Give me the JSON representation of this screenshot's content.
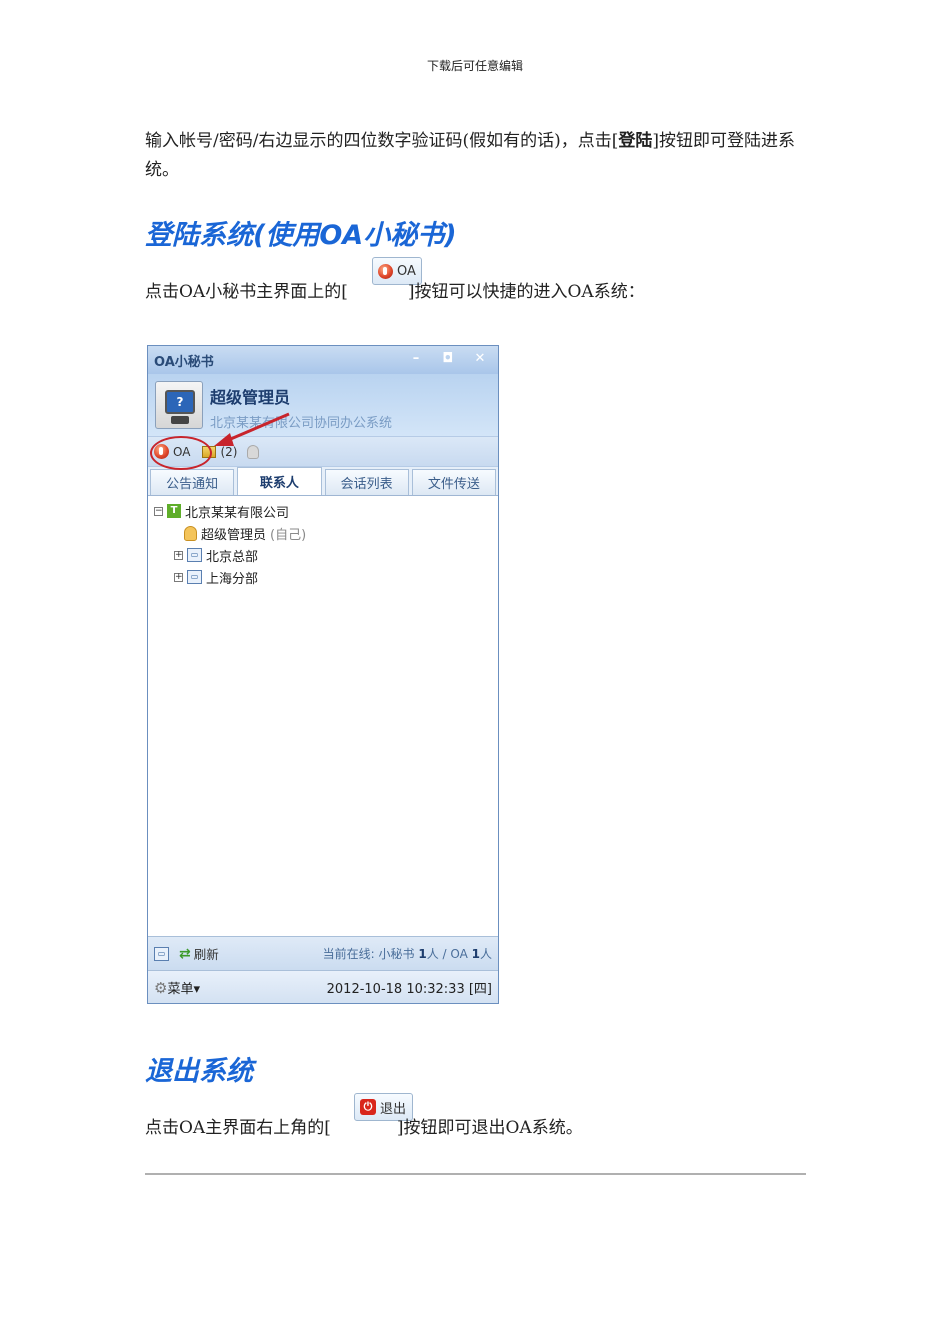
{
  "header_note": "下载后可任意编辑",
  "intro": {
    "part1": "输入帐号/密码/右边显示的四位数字验证码(假如有的话)，点击[",
    "bold": "登陆",
    "part2": "]按钮即可登陆进系统。"
  },
  "section_login": {
    "heading": "登陆系统(使用OA小秘书)",
    "button_label": "OA",
    "text_before": "点击OA小秘书主界面上的[",
    "text_after": "]按钮可以快捷的进入OA系统："
  },
  "oa_window": {
    "title": "OA小秘书",
    "controls": [
      "–",
      "◘",
      "✕"
    ],
    "user_name": "超级管理员",
    "company_subtitle": "北京某某有限公司协同办公系统",
    "toolbar": {
      "oa_label": "OA",
      "message_count": "(2)"
    },
    "tabs": [
      {
        "label": "公告通知"
      },
      {
        "label": "联系人"
      },
      {
        "label": "会话列表"
      },
      {
        "label": "文件传送"
      }
    ],
    "tree": {
      "root": "北京某某有限公司",
      "self_user": "超级管理员",
      "self_tag": "(自己)",
      "departments": [
        "北京总部",
        "上海分部"
      ]
    },
    "status": {
      "refresh_label": "刷新",
      "online_prefix": "当前在线: 小秘书 ",
      "online_count_1": "1",
      "online_mid": "人 / OA ",
      "online_count_2": "1",
      "online_suffix": "人"
    },
    "menu_label": "菜单",
    "datetime": "2012-10-18 10:32:33 [四]",
    "accent_color": "#c8242c"
  },
  "section_logout": {
    "heading": "退出系统",
    "button_label": "退出",
    "text_before": "点击OA主界面右上角的[",
    "text_after": "]按钮即可退出OA系统。"
  }
}
